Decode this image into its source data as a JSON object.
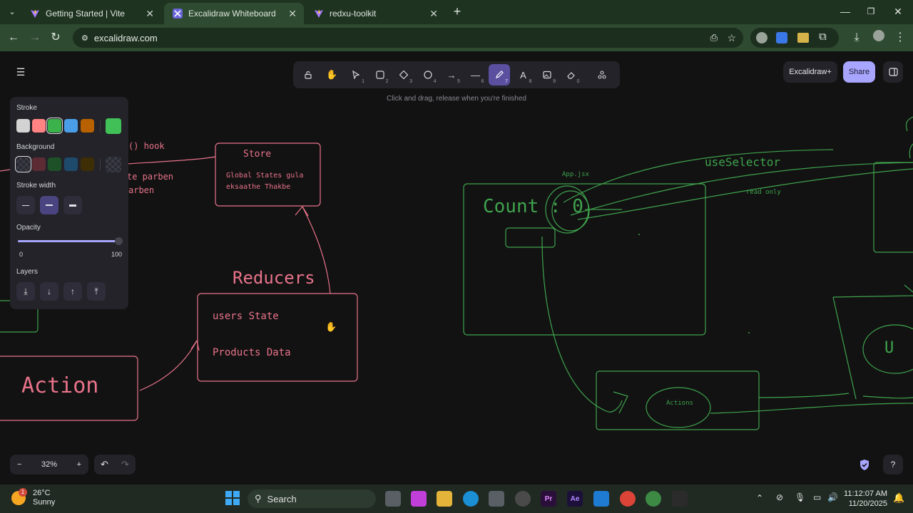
{
  "browser": {
    "tabs": [
      {
        "title": "Getting Started | Vite",
        "active": false
      },
      {
        "title": "Excalidraw Whiteboard",
        "active": true
      },
      {
        "title": "redxu-toolkit",
        "active": false
      }
    ],
    "new_tab": "+",
    "url": "excalidraw.com",
    "window_controls": [
      "minimize",
      "maximize",
      "close"
    ]
  },
  "toolbar": {
    "tools": [
      {
        "icon": "lock-icon",
        "num": ""
      },
      {
        "icon": "hand-icon",
        "num": ""
      },
      {
        "icon": "selection-icon",
        "num": "1"
      },
      {
        "icon": "rectangle-icon",
        "num": "2"
      },
      {
        "icon": "diamond-icon",
        "num": "3"
      },
      {
        "icon": "ellipse-icon",
        "num": "4"
      },
      {
        "icon": "arrow-icon",
        "num": "5"
      },
      {
        "icon": "line-icon",
        "num": "6"
      },
      {
        "icon": "pencil-icon",
        "num": "7",
        "active": true
      },
      {
        "icon": "text-icon",
        "num": "8"
      },
      {
        "icon": "image-icon",
        "num": "9"
      },
      {
        "icon": "eraser-icon",
        "num": "0"
      },
      {
        "icon": "more-tools-icon",
        "num": ""
      }
    ],
    "hint": "Click and drag, release when you're finished"
  },
  "topright": {
    "excalidraw_plus": "Excalidraw+",
    "share": "Share"
  },
  "panel": {
    "stroke_label": "Stroke",
    "stroke_colors": [
      "#d3d3d3",
      "#ff8383",
      "#3bb34a",
      "#4a9ee8",
      "#b76100"
    ],
    "stroke_selected": "#40c057",
    "background_label": "Background",
    "background_colors": [
      "transparent",
      "#5c2b33",
      "#1e5128",
      "#1e4a6b",
      "#3d2e05"
    ],
    "stroke_width_label": "Stroke width",
    "opacity_label": "Opacity",
    "opacity_min": "0",
    "opacity_max": "100",
    "opacity_value": 1.0,
    "layers_label": "Layers"
  },
  "canvas_text": {
    "hook": "() hook",
    "te_parben": "te parben",
    "arben": "arben",
    "store": "Store",
    "store_note_1": "Global States gula",
    "store_note_2": "eksaathe Thakbe",
    "reducers": "Reducers",
    "users_state": "users State",
    "products_data": "Products Data",
    "action": "Action",
    "app_jsx": "App.jsx",
    "count": "Count : 0",
    "use_selector": "useSelector",
    "read_only": "read only",
    "actions": "Actions",
    "u": "U"
  },
  "colors": {
    "pink": "#e8738a",
    "green": "#3fa34d",
    "purple": "#a8a5ff"
  },
  "zoom": {
    "minus": "−",
    "value": "32%",
    "plus": "+"
  },
  "taskbar": {
    "weather_temp": "26°C",
    "weather_desc": "Sunny",
    "weather_badge": "1",
    "search": "Search",
    "time": "11:12:07 AM",
    "date": "11/20/2025"
  }
}
